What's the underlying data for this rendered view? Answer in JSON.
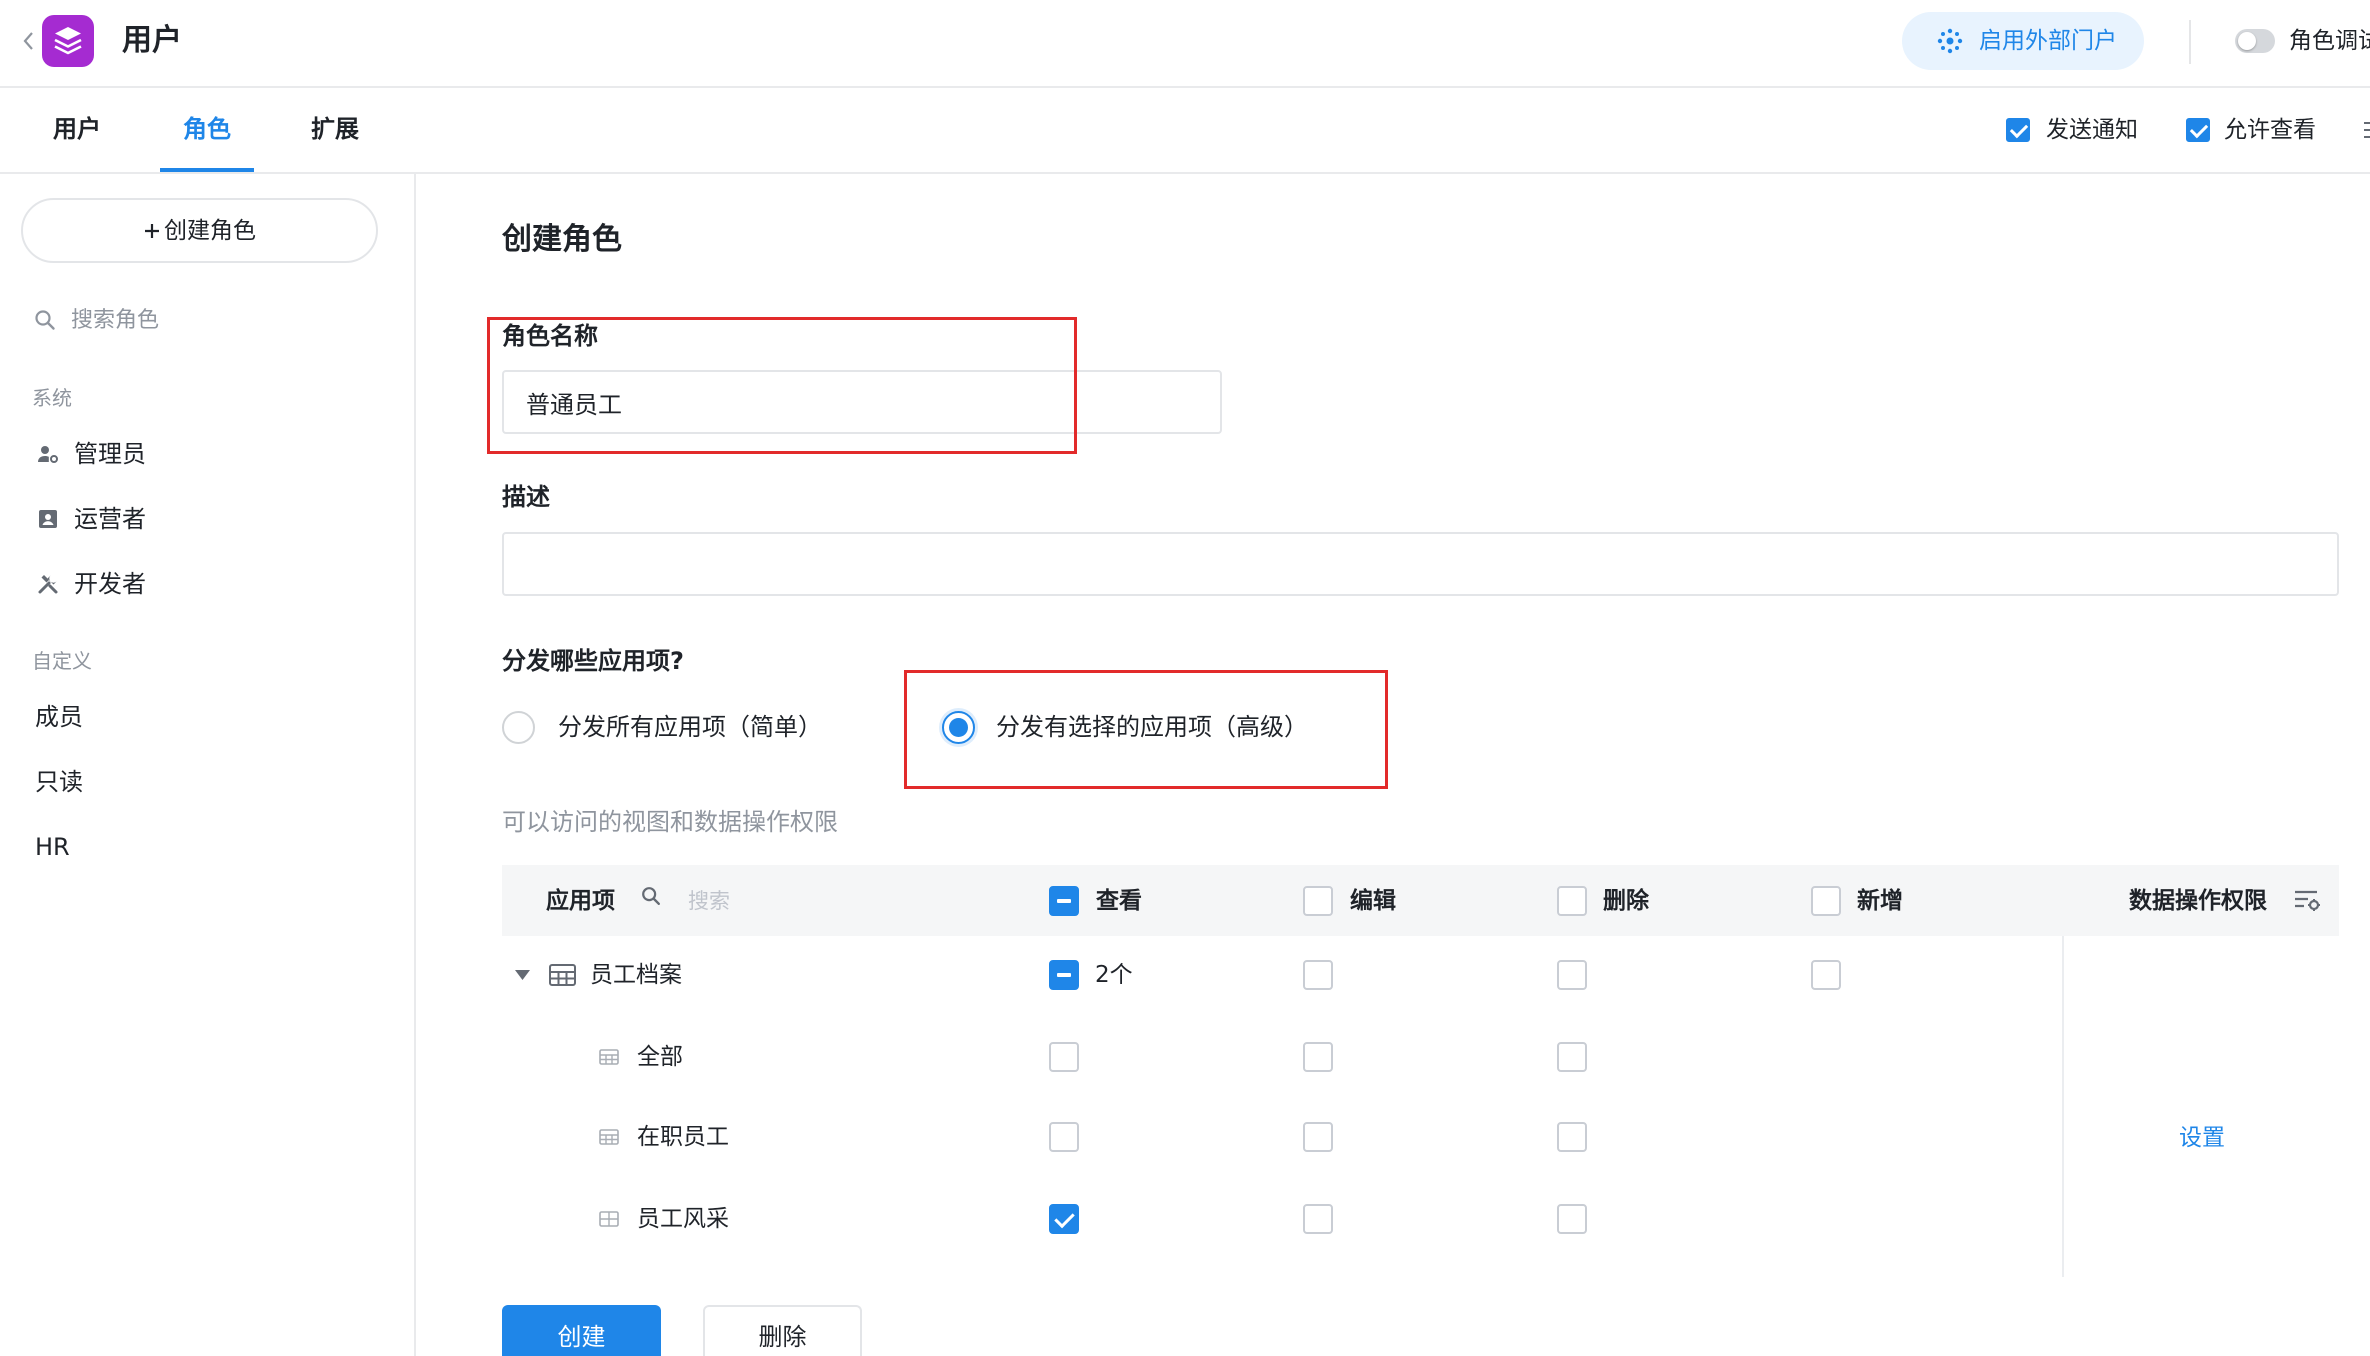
{
  "theme": {
    "accent": "#1f86e8",
    "highlight": "#e22a2a",
    "logo": "#a52bd1",
    "portal_bg": "#e8f3fe"
  },
  "app": {
    "title": "用户",
    "logo_icon": "app-logo-icon",
    "back_icon": "chevron-left-icon"
  },
  "header": {
    "portal_button": {
      "label": "启用外部门户",
      "icon": "portal-icon"
    },
    "role_debug": {
      "label": "角色调试",
      "enabled": false
    }
  },
  "tabs": [
    {
      "label": "用户",
      "active": false
    },
    {
      "label": "角色",
      "active": true
    },
    {
      "label": "扩展",
      "active": false
    }
  ],
  "tab_options": [
    {
      "label": "发送通知",
      "checked": true
    },
    {
      "label": "允许查看",
      "checked": true
    }
  ],
  "sidebar": {
    "create_button": {
      "label": "创建角色",
      "icon": "plus-icon"
    },
    "search": {
      "placeholder": "搜索角色",
      "icon": "search-icon"
    },
    "groups": [
      {
        "label": "系统",
        "items": [
          {
            "label": "管理员",
            "icon": "admin-icon"
          },
          {
            "label": "运营者",
            "icon": "operator-badge-icon"
          },
          {
            "label": "开发者",
            "icon": "tools-icon"
          }
        ]
      },
      {
        "label": "自定义",
        "items": [
          {
            "label": "成员"
          },
          {
            "label": "只读"
          },
          {
            "label": "HR"
          }
        ]
      }
    ]
  },
  "form": {
    "title": "创建角色",
    "role_name": {
      "label": "角色名称",
      "value": "普通员工"
    },
    "description": {
      "label": "描述",
      "value": ""
    },
    "distribute": {
      "label": "分发哪些应用项?",
      "options": [
        {
          "label": "分发所有应用项（简单）",
          "selected": false
        },
        {
          "label": "分发有选择的应用项（高级）",
          "selected": true
        }
      ]
    },
    "permissions_hint": "可以访问的视图和数据操作权限"
  },
  "permissions_table": {
    "header": {
      "app_column": "应用项",
      "search_placeholder": "搜索",
      "columns": [
        {
          "label": "查看",
          "checked": false,
          "partial": true
        },
        {
          "label": "编辑",
          "checked": false
        },
        {
          "label": "删除",
          "checked": false
        },
        {
          "label": "新增",
          "checked": false
        }
      ],
      "data_permission": {
        "label": "数据操作权限",
        "icon": "filter-settings-icon"
      }
    },
    "rows": [
      {
        "name": "员工档案",
        "icon": "table-icon",
        "expanded": true,
        "view": {
          "checked": false,
          "partial": true
        },
        "view_count": "2个",
        "edit": {
          "checked": false
        },
        "delete": {
          "checked": false
        },
        "add": {
          "checked": false
        }
      },
      {
        "name": "全部",
        "icon": "grid-view-icon",
        "view": {
          "checked": false
        },
        "edit": {
          "checked": false
        },
        "delete": {
          "checked": false
        }
      },
      {
        "name": "在职员工",
        "icon": "grid-view-icon",
        "view": {
          "checked": false
        },
        "edit": {
          "checked": false
        },
        "delete": {
          "checked": false
        }
      },
      {
        "name": "员工风采",
        "icon": "gallery-view-icon",
        "view": {
          "checked": true
        },
        "edit": {
          "checked": false
        },
        "delete": {
          "checked": false
        }
      }
    ],
    "settings_link": "设置"
  },
  "actions": {
    "create": "创建",
    "delete": "删除"
  }
}
